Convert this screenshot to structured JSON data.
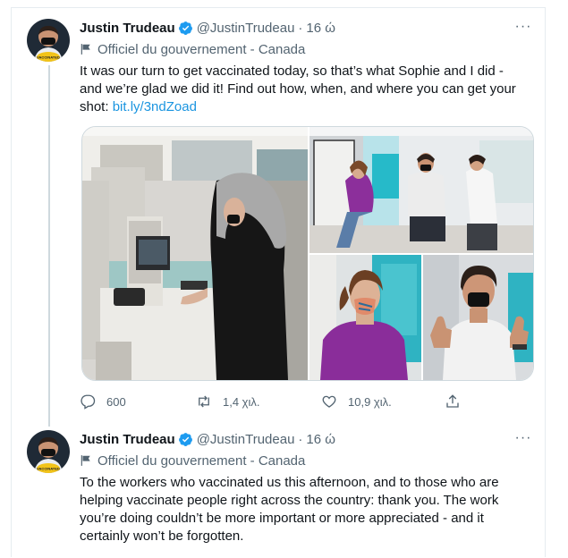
{
  "tweets": [
    {
      "author_name": "Justin Trudeau",
      "handle": "@JustinTrudeau",
      "separator": "·",
      "time": "16 ώ",
      "label": "Officiel du gouvernement - Canada",
      "text_main": "It was our turn to get vaccinated today, so that’s what Sophie and I did - and we’re glad we did it! Find out how, when, and where you can get your shot: ",
      "link": "bit.ly/3ndZoad",
      "more": "···",
      "replies": "600",
      "retweets": "1,4 χιλ.",
      "likes": "10,9 χιλ.",
      "avatar_badge": "VACCINATED"
    },
    {
      "author_name": "Justin Trudeau",
      "handle": "@JustinTrudeau",
      "separator": "·",
      "time": "16 ώ",
      "label": "Officiel du gouvernement - Canada",
      "text_main": "To the workers who vaccinated us this afternoon, and to those who are helping vaccinate people right across the country: thank you. The work you’re doing couldn’t be more important or more appreciated - and it certainly won’t be forgotten.",
      "more": "···",
      "avatar_badge": "VACCINATED"
    }
  ],
  "colors": {
    "accent": "#1d9bf0",
    "verified": "#1d9bf0",
    "muted": "#536471",
    "link": "#1b95e0"
  },
  "icons": [
    "verified-badge-icon",
    "government-flag-icon",
    "reply-icon",
    "retweet-icon",
    "like-icon",
    "share-icon",
    "more-icon"
  ]
}
